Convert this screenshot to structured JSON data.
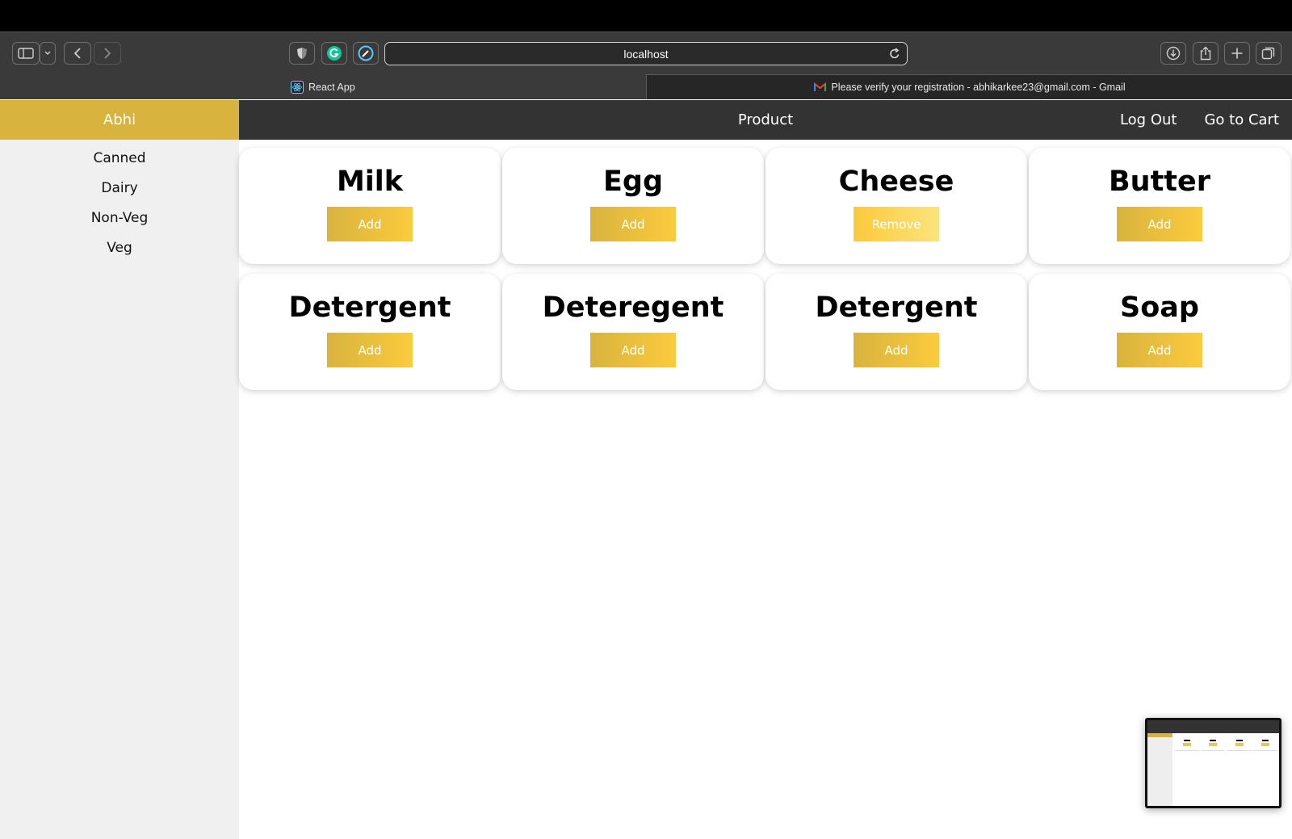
{
  "browser": {
    "url": "localhost",
    "tabs": [
      {
        "title": "React App",
        "active": true
      },
      {
        "title": "Please verify your registration - abhikarkee23@gmail.com - Gmail",
        "active": false
      }
    ]
  },
  "sidebar": {
    "user": "Abhi",
    "categories": [
      "Canned",
      "Dairy",
      "Non-Veg",
      "Veg"
    ]
  },
  "nav": {
    "title": "Product",
    "logout": "Log Out",
    "cart": "Go to Cart"
  },
  "products": [
    {
      "name": "Milk",
      "action": "Add"
    },
    {
      "name": "Egg",
      "action": "Add"
    },
    {
      "name": "Cheese",
      "action": "Remove"
    },
    {
      "name": "Butter",
      "action": "Add"
    },
    {
      "name": "Detergent",
      "action": "Add"
    },
    {
      "name": "Deteregent",
      "action": "Add"
    },
    {
      "name": "Detergent",
      "action": "Add"
    },
    {
      "name": "Soap",
      "action": "Add"
    }
  ],
  "colors": {
    "accent": "#d8b33e",
    "accent_light": "#fccb3d",
    "nav_bg": "#333333",
    "sidebar_bg": "#f0f0f0"
  }
}
